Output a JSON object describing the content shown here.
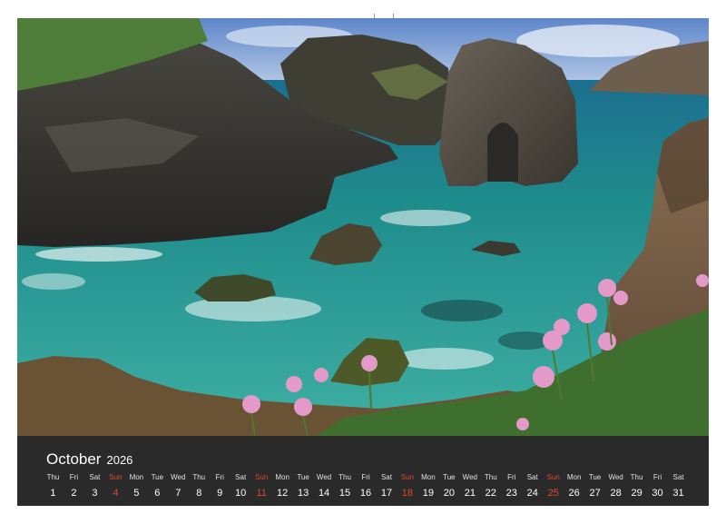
{
  "calendar": {
    "month": "October",
    "year": "2026",
    "sunday_color": "#e0473c",
    "days": [
      {
        "dow": "Thu",
        "num": "1",
        "sunday": false
      },
      {
        "dow": "Fri",
        "num": "2",
        "sunday": false
      },
      {
        "dow": "Sat",
        "num": "3",
        "sunday": false
      },
      {
        "dow": "Sun",
        "num": "4",
        "sunday": true
      },
      {
        "dow": "Mon",
        "num": "5",
        "sunday": false
      },
      {
        "dow": "Tue",
        "num": "6",
        "sunday": false
      },
      {
        "dow": "Wed",
        "num": "7",
        "sunday": false
      },
      {
        "dow": "Thu",
        "num": "8",
        "sunday": false
      },
      {
        "dow": "Fri",
        "num": "9",
        "sunday": false
      },
      {
        "dow": "Sat",
        "num": "10",
        "sunday": false
      },
      {
        "dow": "Sun",
        "num": "11",
        "sunday": true
      },
      {
        "dow": "Mon",
        "num": "12",
        "sunday": false
      },
      {
        "dow": "Tue",
        "num": "13",
        "sunday": false
      },
      {
        "dow": "Wed",
        "num": "14",
        "sunday": false
      },
      {
        "dow": "Thu",
        "num": "15",
        "sunday": false
      },
      {
        "dow": "Fri",
        "num": "16",
        "sunday": false
      },
      {
        "dow": "Sat",
        "num": "17",
        "sunday": false
      },
      {
        "dow": "Sun",
        "num": "18",
        "sunday": true
      },
      {
        "dow": "Mon",
        "num": "19",
        "sunday": false
      },
      {
        "dow": "Tue",
        "num": "20",
        "sunday": false
      },
      {
        "dow": "Wed",
        "num": "21",
        "sunday": false
      },
      {
        "dow": "Thu",
        "num": "22",
        "sunday": false
      },
      {
        "dow": "Fri",
        "num": "23",
        "sunday": false
      },
      {
        "dow": "Sat",
        "num": "24",
        "sunday": false
      },
      {
        "dow": "Sun",
        "num": "25",
        "sunday": true
      },
      {
        "dow": "Mon",
        "num": "26",
        "sunday": false
      },
      {
        "dow": "Tue",
        "num": "27",
        "sunday": false
      },
      {
        "dow": "Wed",
        "num": "28",
        "sunday": false
      },
      {
        "dow": "Thu",
        "num": "29",
        "sunday": false
      },
      {
        "dow": "Fri",
        "num": "30",
        "sunday": false
      },
      {
        "dow": "Sat",
        "num": "31",
        "sunday": false
      }
    ]
  }
}
